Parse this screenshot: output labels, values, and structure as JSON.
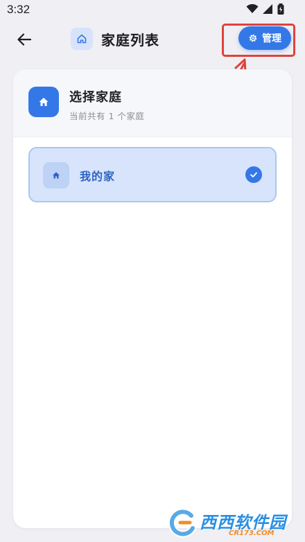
{
  "status_bar": {
    "time": "3:32"
  },
  "header": {
    "title": "家庭列表",
    "manage_label": "管理",
    "icons": {
      "back": "arrow-left-icon",
      "title": "home-outline-icon",
      "manage": "gear-icon"
    }
  },
  "card": {
    "title": "选择家庭",
    "subtitle": "当前共有 1 个家庭",
    "families": [
      {
        "name": "我的家",
        "selected": true
      }
    ]
  },
  "watermark": {
    "text": "西西软件园",
    "sub": "CR173.COM"
  },
  "colors": {
    "accent": "#3478e8",
    "selected_bg": "#d7e4fb",
    "selected_border": "#a9c6f3",
    "annotation": "#e1413a"
  }
}
